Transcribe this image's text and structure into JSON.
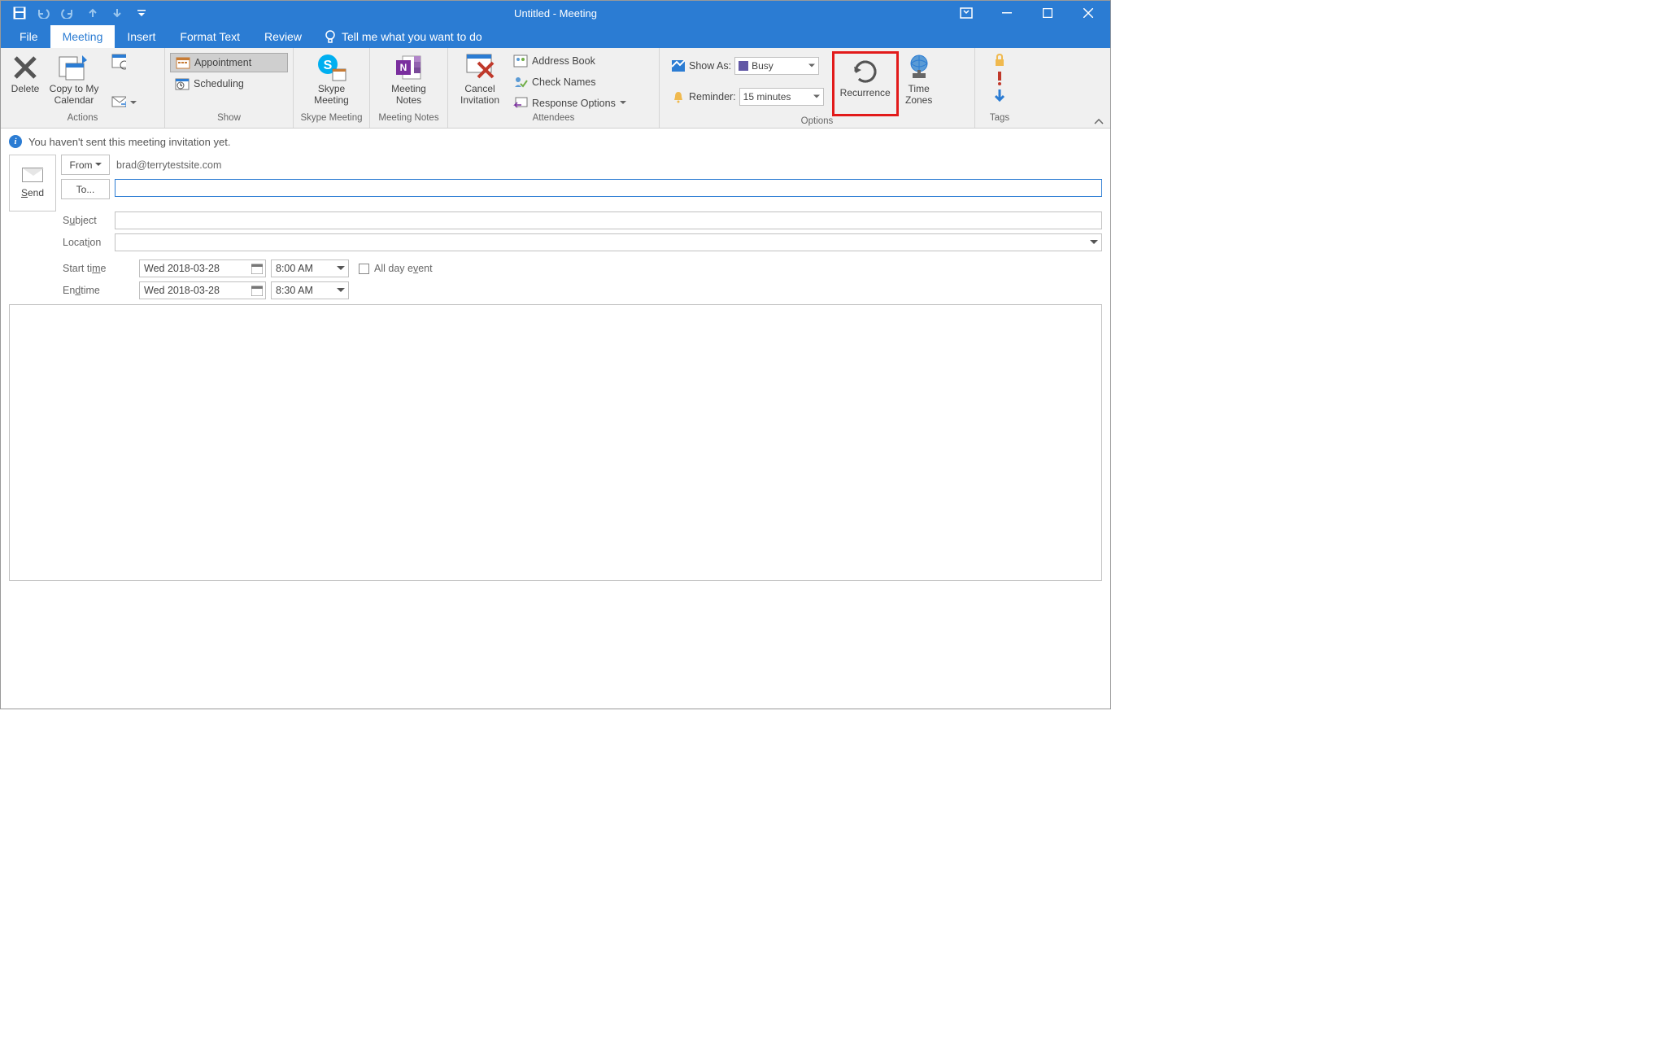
{
  "title": "Untitled  -  Meeting",
  "tabs": {
    "file": "File",
    "meeting": "Meeting",
    "insert": "Insert",
    "format": "Format Text",
    "review": "Review",
    "tellme": "Tell me what you want to do"
  },
  "ribbon": {
    "actions": {
      "label": "Actions",
      "delete": "Delete",
      "copyto": "Copy to My\nCalendar"
    },
    "show": {
      "label": "Show",
      "appointment": "Appointment",
      "scheduling": "Scheduling"
    },
    "skype": {
      "label": "Skype Meeting",
      "btn": "Skype\nMeeting"
    },
    "notes": {
      "label": "Meeting Notes",
      "btn": "Meeting\nNotes"
    },
    "attendees": {
      "label": "Attendees",
      "cancel": "Cancel\nInvitation",
      "addressbook": "Address Book",
      "checknames": "Check Names",
      "response": "Response Options"
    },
    "options": {
      "label": "Options",
      "showas": "Show As:",
      "showas_val": "Busy",
      "reminder": "Reminder:",
      "reminder_val": "15 minutes",
      "recurrence": "Recurrence",
      "timezones": "Time\nZones"
    },
    "tags": {
      "label": "Tags"
    }
  },
  "infobar": "You haven't sent this meeting invitation yet.",
  "form": {
    "send": "Send",
    "from_label": "From",
    "from_value": "brad@terrytestsite.com",
    "to_label": "To...",
    "to_value": "",
    "subject_label": "Subject",
    "subject_value": "",
    "location_label": "Location",
    "location_value": "",
    "start_label": "Start time",
    "start_date": "Wed 2018-03-28",
    "start_time": "8:00 AM",
    "end_label": "End time",
    "end_date": "Wed 2018-03-28",
    "end_time": "8:30 AM",
    "allday": "All day event"
  }
}
